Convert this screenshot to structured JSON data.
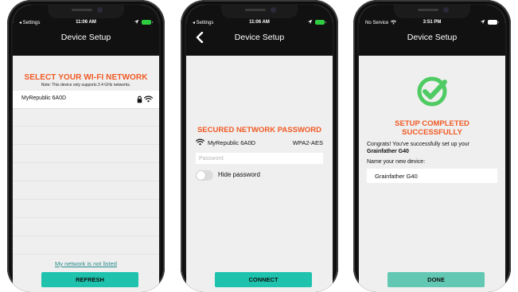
{
  "colors": {
    "accent_orange": "#f15a24",
    "button_teal": "#1ec2ad",
    "link_teal": "#2a8a8a",
    "header_black": "#111111"
  },
  "screen1": {
    "status": {
      "back_label": "◂ Settings",
      "time": "11:06 AM"
    },
    "header": {
      "title": "Device Setup"
    },
    "title": "SELECT YOUR WI-FI NETWORK",
    "note": "Note: This device only supports 2.4 GHz networks.",
    "networks": [
      {
        "name": "MyRepublic 6A0D",
        "icons": [
          "lock-icon",
          "wifi-icon"
        ]
      }
    ],
    "not_listed_link": "My network is not listed",
    "refresh_button": "REFRESH"
  },
  "screen2": {
    "status": {
      "back_label": "◂ Settings",
      "time": "11:06 AM"
    },
    "header": {
      "title": "Device Setup"
    },
    "title": "SECURED NETWORK PASSWORD",
    "network_name": "MyRepublic 6A0D",
    "security": "WPA2-AES",
    "password": {
      "value": "",
      "placeholder": "Password"
    },
    "hide_password_label": "Hide password",
    "connect_button": "CONNECT"
  },
  "screen3": {
    "status": {
      "carrier": "No Service",
      "time": "3:51 PM"
    },
    "header": {
      "title": "Device Setup"
    },
    "title_line1": "SETUP COMPLETED",
    "title_line2": "SUCCESSFULLY",
    "congrats_text": "Congrats! You've successfully set up your",
    "device_model": "Grainfather G40",
    "name_label": "Name your new device:",
    "device_name_value": "Grainfather G40",
    "done_button": "DONE"
  }
}
